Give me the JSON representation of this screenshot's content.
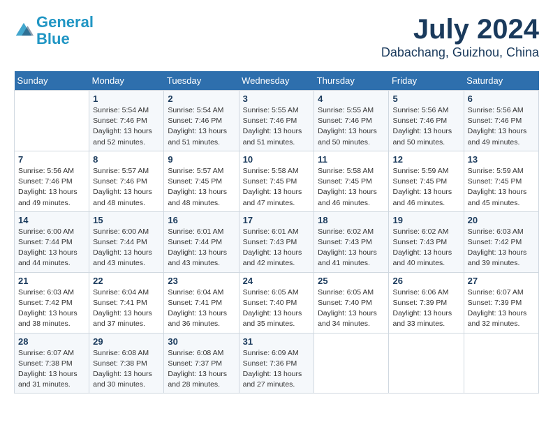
{
  "header": {
    "logo_line1": "General",
    "logo_line2": "Blue",
    "month": "July 2024",
    "location": "Dabachang, Guizhou, China"
  },
  "weekdays": [
    "Sunday",
    "Monday",
    "Tuesday",
    "Wednesday",
    "Thursday",
    "Friday",
    "Saturday"
  ],
  "weeks": [
    [
      {
        "day": "",
        "info": ""
      },
      {
        "day": "1",
        "info": "Sunrise: 5:54 AM\nSunset: 7:46 PM\nDaylight: 13 hours\nand 52 minutes."
      },
      {
        "day": "2",
        "info": "Sunrise: 5:54 AM\nSunset: 7:46 PM\nDaylight: 13 hours\nand 51 minutes."
      },
      {
        "day": "3",
        "info": "Sunrise: 5:55 AM\nSunset: 7:46 PM\nDaylight: 13 hours\nand 51 minutes."
      },
      {
        "day": "4",
        "info": "Sunrise: 5:55 AM\nSunset: 7:46 PM\nDaylight: 13 hours\nand 50 minutes."
      },
      {
        "day": "5",
        "info": "Sunrise: 5:56 AM\nSunset: 7:46 PM\nDaylight: 13 hours\nand 50 minutes."
      },
      {
        "day": "6",
        "info": "Sunrise: 5:56 AM\nSunset: 7:46 PM\nDaylight: 13 hours\nand 49 minutes."
      }
    ],
    [
      {
        "day": "7",
        "info": "Sunrise: 5:56 AM\nSunset: 7:46 PM\nDaylight: 13 hours\nand 49 minutes."
      },
      {
        "day": "8",
        "info": "Sunrise: 5:57 AM\nSunset: 7:46 PM\nDaylight: 13 hours\nand 48 minutes."
      },
      {
        "day": "9",
        "info": "Sunrise: 5:57 AM\nSunset: 7:45 PM\nDaylight: 13 hours\nand 48 minutes."
      },
      {
        "day": "10",
        "info": "Sunrise: 5:58 AM\nSunset: 7:45 PM\nDaylight: 13 hours\nand 47 minutes."
      },
      {
        "day": "11",
        "info": "Sunrise: 5:58 AM\nSunset: 7:45 PM\nDaylight: 13 hours\nand 46 minutes."
      },
      {
        "day": "12",
        "info": "Sunrise: 5:59 AM\nSunset: 7:45 PM\nDaylight: 13 hours\nand 46 minutes."
      },
      {
        "day": "13",
        "info": "Sunrise: 5:59 AM\nSunset: 7:45 PM\nDaylight: 13 hours\nand 45 minutes."
      }
    ],
    [
      {
        "day": "14",
        "info": "Sunrise: 6:00 AM\nSunset: 7:44 PM\nDaylight: 13 hours\nand 44 minutes."
      },
      {
        "day": "15",
        "info": "Sunrise: 6:00 AM\nSunset: 7:44 PM\nDaylight: 13 hours\nand 43 minutes."
      },
      {
        "day": "16",
        "info": "Sunrise: 6:01 AM\nSunset: 7:44 PM\nDaylight: 13 hours\nand 43 minutes."
      },
      {
        "day": "17",
        "info": "Sunrise: 6:01 AM\nSunset: 7:43 PM\nDaylight: 13 hours\nand 42 minutes."
      },
      {
        "day": "18",
        "info": "Sunrise: 6:02 AM\nSunset: 7:43 PM\nDaylight: 13 hours\nand 41 minutes."
      },
      {
        "day": "19",
        "info": "Sunrise: 6:02 AM\nSunset: 7:43 PM\nDaylight: 13 hours\nand 40 minutes."
      },
      {
        "day": "20",
        "info": "Sunrise: 6:03 AM\nSunset: 7:42 PM\nDaylight: 13 hours\nand 39 minutes."
      }
    ],
    [
      {
        "day": "21",
        "info": "Sunrise: 6:03 AM\nSunset: 7:42 PM\nDaylight: 13 hours\nand 38 minutes."
      },
      {
        "day": "22",
        "info": "Sunrise: 6:04 AM\nSunset: 7:41 PM\nDaylight: 13 hours\nand 37 minutes."
      },
      {
        "day": "23",
        "info": "Sunrise: 6:04 AM\nSunset: 7:41 PM\nDaylight: 13 hours\nand 36 minutes."
      },
      {
        "day": "24",
        "info": "Sunrise: 6:05 AM\nSunset: 7:40 PM\nDaylight: 13 hours\nand 35 minutes."
      },
      {
        "day": "25",
        "info": "Sunrise: 6:05 AM\nSunset: 7:40 PM\nDaylight: 13 hours\nand 34 minutes."
      },
      {
        "day": "26",
        "info": "Sunrise: 6:06 AM\nSunset: 7:39 PM\nDaylight: 13 hours\nand 33 minutes."
      },
      {
        "day": "27",
        "info": "Sunrise: 6:07 AM\nSunset: 7:39 PM\nDaylight: 13 hours\nand 32 minutes."
      }
    ],
    [
      {
        "day": "28",
        "info": "Sunrise: 6:07 AM\nSunset: 7:38 PM\nDaylight: 13 hours\nand 31 minutes."
      },
      {
        "day": "29",
        "info": "Sunrise: 6:08 AM\nSunset: 7:38 PM\nDaylight: 13 hours\nand 30 minutes."
      },
      {
        "day": "30",
        "info": "Sunrise: 6:08 AM\nSunset: 7:37 PM\nDaylight: 13 hours\nand 28 minutes."
      },
      {
        "day": "31",
        "info": "Sunrise: 6:09 AM\nSunset: 7:36 PM\nDaylight: 13 hours\nand 27 minutes."
      },
      {
        "day": "",
        "info": ""
      },
      {
        "day": "",
        "info": ""
      },
      {
        "day": "",
        "info": ""
      }
    ]
  ]
}
